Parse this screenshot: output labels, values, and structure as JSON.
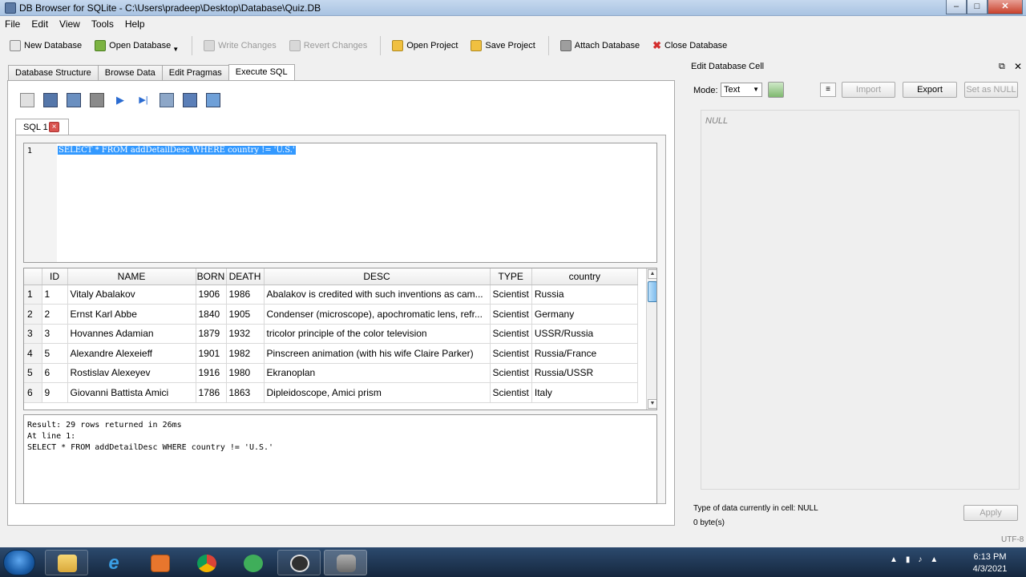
{
  "window": {
    "title": "DB Browser for SQLite - C:\\Users\\pradeep\\Desktop\\Database\\Quiz.DB"
  },
  "menu": [
    "File",
    "Edit",
    "View",
    "Tools",
    "Help"
  ],
  "toolbar": {
    "new_db": "New Database",
    "open_db": "Open Database",
    "write_changes": "Write Changes",
    "revert_changes": "Revert Changes",
    "open_project": "Open Project",
    "save_project": "Save Project",
    "attach_db": "Attach Database",
    "close_db": "Close Database"
  },
  "tabs": [
    "Database Structure",
    "Browse Data",
    "Edit Pragmas",
    "Execute SQL"
  ],
  "sql_tab": {
    "label": "SQL 1"
  },
  "editor": {
    "line_number": "1",
    "query": "SELECT * FROM addDetailDesc WHERE country != 'U.S.'"
  },
  "grid": {
    "columns": [
      "ID",
      "NAME",
      "BORN",
      "DEATH",
      "DESC",
      "TYPE",
      "country"
    ],
    "rows": [
      {
        "n": "1",
        "id": "1",
        "name": "Vitaly Abalakov",
        "born": "1906",
        "death": "1986",
        "desc": "Abalakov is credited with such inventions as cam...",
        "type": "Scientist",
        "country": "Russia"
      },
      {
        "n": "2",
        "id": "2",
        "name": "Ernst Karl Abbe",
        "born": "1840",
        "death": "1905",
        "desc": "Condenser (microscope), apochromatic lens, refr...",
        "type": "Scientist",
        "country": "Germany"
      },
      {
        "n": "3",
        "id": "3",
        "name": "Hovannes Adamian",
        "born": "1879",
        "death": "1932",
        "desc": "tricolor principle of the color television",
        "type": "Scientist",
        "country": "USSR/Russia"
      },
      {
        "n": "4",
        "id": "5",
        "name": "Alexandre Alexeieff",
        "born": "1901",
        "death": "1982",
        "desc": "Pinscreen animation (with his wife Claire Parker)",
        "type": "Scientist",
        "country": "Russia/France"
      },
      {
        "n": "5",
        "id": "6",
        "name": "Rostislav Alexeyev",
        "born": "1916",
        "death": "1980",
        "desc": "Ekranoplan",
        "type": "Scientist",
        "country": "Russia/USSR"
      },
      {
        "n": "6",
        "id": "9",
        "name": "Giovanni Battista Amici",
        "born": "1786",
        "death": "1863",
        "desc": "Dipleidoscope, Amici prism",
        "type": "Scientist",
        "country": "Italy"
      }
    ]
  },
  "result": {
    "line1": "Result: 29 rows returned in 26ms",
    "line2": "At line 1:",
    "line3": "SELECT * FROM addDetailDesc WHERE country != 'U.S.'"
  },
  "edit_cell": {
    "title": "Edit Database Cell",
    "mode_label": "Mode:",
    "mode_value": "Text",
    "import": "Import",
    "export": "Export",
    "set_null": "Set as NULL",
    "null_text": "NULL",
    "type_info": "Type of data currently in cell: NULL",
    "size_info": "0 byte(s)",
    "apply": "Apply"
  },
  "status": {
    "encoding": "UTF-8"
  },
  "clock": {
    "time": "6:13 PM",
    "date": "4/3/2021"
  }
}
